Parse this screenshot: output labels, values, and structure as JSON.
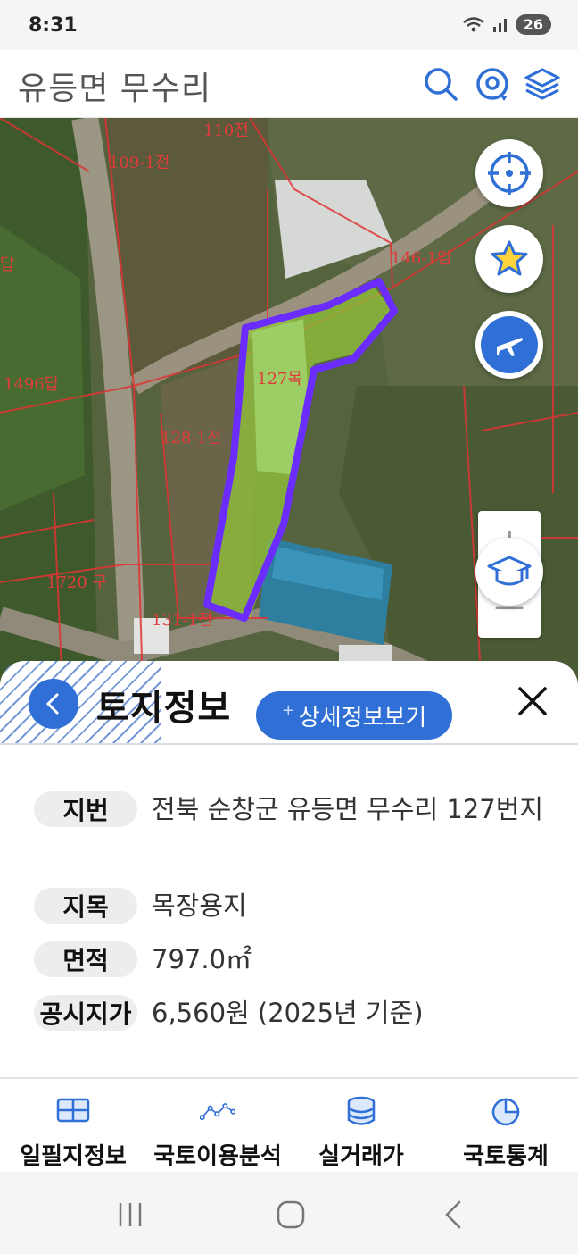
{
  "status_bar": {
    "time": "8:31",
    "battery": "26"
  },
  "header": {
    "title": "유등면 무수리",
    "icons": [
      "search-icon",
      "location-target-icon",
      "layers-icon"
    ]
  },
  "map": {
    "parcel_labels": {
      "p110": "110전",
      "p109": "109-1전",
      "p146": "146-1임",
      "p496": "1496답",
      "p127": "127목",
      "p128": "128-1전",
      "p1720": "1720 구",
      "p131": "131-1전",
      "p0": "답"
    },
    "controls": {
      "zoom_in": "+",
      "zoom_out": "—"
    },
    "highlight_color": "#6a2cff"
  },
  "sheet": {
    "title": "토지정보",
    "detail_button": "상세정보보기",
    "rows": [
      {
        "label": "지번",
        "value": "전북 순창군 유등면 무수리 127번지"
      },
      {
        "label": "지목",
        "value": "목장용지"
      },
      {
        "label": "면적",
        "value": "797.0㎡"
      },
      {
        "label": "공시지가",
        "value": "6,560원 (2025년 기준)"
      }
    ]
  },
  "bottom_nav": [
    {
      "label": "일필지정보",
      "icon": "grid-map-icon"
    },
    {
      "label": "국토이용분석",
      "icon": "line-chart-icon"
    },
    {
      "label": "실거래가",
      "icon": "database-icon"
    },
    {
      "label": "국토통계",
      "icon": "pie-chart-icon"
    }
  ],
  "colors": {
    "accent": "#2f6fd6",
    "parcel_lines": "#e23b3b"
  }
}
